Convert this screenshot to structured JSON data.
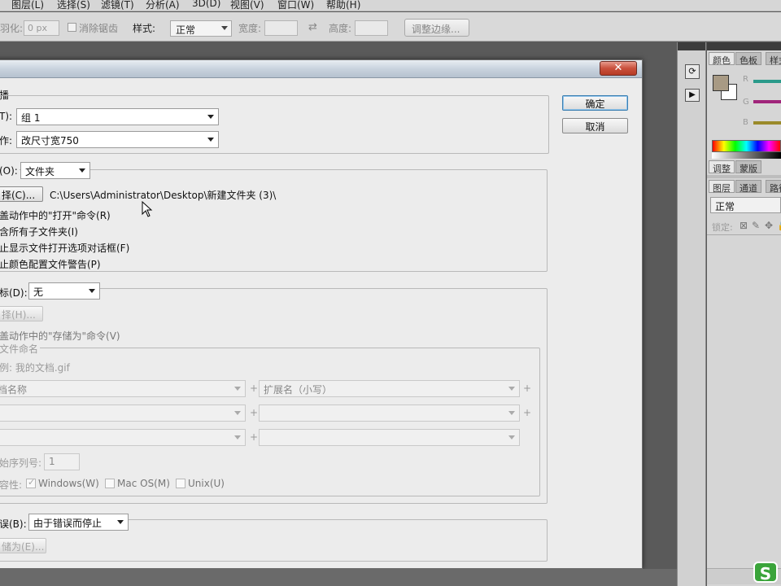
{
  "menu": {
    "items": [
      "图层(L)",
      "选择(S)",
      "滤镜(T)",
      "分析(A)",
      "3D(D)",
      "视图(V)",
      "窗口(W)",
      "帮助(H)"
    ]
  },
  "options_bar": {
    "feather_label": "羽化:",
    "feather_value": "0 px",
    "antialias_label": "消除锯齿",
    "style_label": "样式:",
    "style_value": "正常",
    "width_label": "宽度:",
    "height_label": "高度:",
    "swap_icon": "⇄",
    "refine_edge_button": "调整边缘..."
  },
  "right_panel": {
    "color_tabs": [
      "颜色",
      "色板",
      "样式"
    ],
    "channels": [
      "R",
      "G",
      "B"
    ],
    "adjust_tabs": [
      "调整",
      "蒙版"
    ],
    "layer_tabs": [
      "图层",
      "通道",
      "路径"
    ],
    "blend_mode": "正常",
    "lock_label": "锁定:",
    "channel_colors": [
      "#2a9a8a",
      "#a0247a",
      "#9a8a2a"
    ],
    "swatch_color": "#a89a84"
  },
  "dialog": {
    "close_label": "✕",
    "ok_button": "确定",
    "cancel_button": "取消",
    "play": {
      "title": "播",
      "set_label": "T):",
      "set_value": "组 1",
      "action_label": "作:",
      "action_value": "改尺寸宽750"
    },
    "source": {
      "label": "(O):",
      "value": "文件夹",
      "choose_button": "择(C)...",
      "path": "C:\\Users\\Administrator\\Desktop\\新建文件夹 (3)\\",
      "opt1": "盖动作中的\"打开\"命令(R)",
      "opt2": "含所有子文件夹(I)",
      "opt3": "止显示文件打开选项对话框(F)",
      "opt4": "止颜色配置文件警告(P)"
    },
    "destination": {
      "label": "标(D):",
      "value": "无",
      "choose_button": "择(H)...",
      "override_save": "盖动作中的\"存储为\"命令(V)",
      "naming_title": "文件命名",
      "example": "例: 我的文档.gif",
      "field1": "档名称",
      "field2": "扩展名（小写）",
      "serial_label": "始序列号:",
      "serial_value": "1",
      "compat_label": "容性:",
      "compat_windows": "Windows(W)",
      "compat_mac": "Mac OS(M)",
      "compat_unix": "Unix(U)"
    },
    "errors": {
      "label": "误(B):",
      "value": "由于错误而停止",
      "save_as_button": "储为(E)..."
    }
  },
  "logo_text": "S"
}
